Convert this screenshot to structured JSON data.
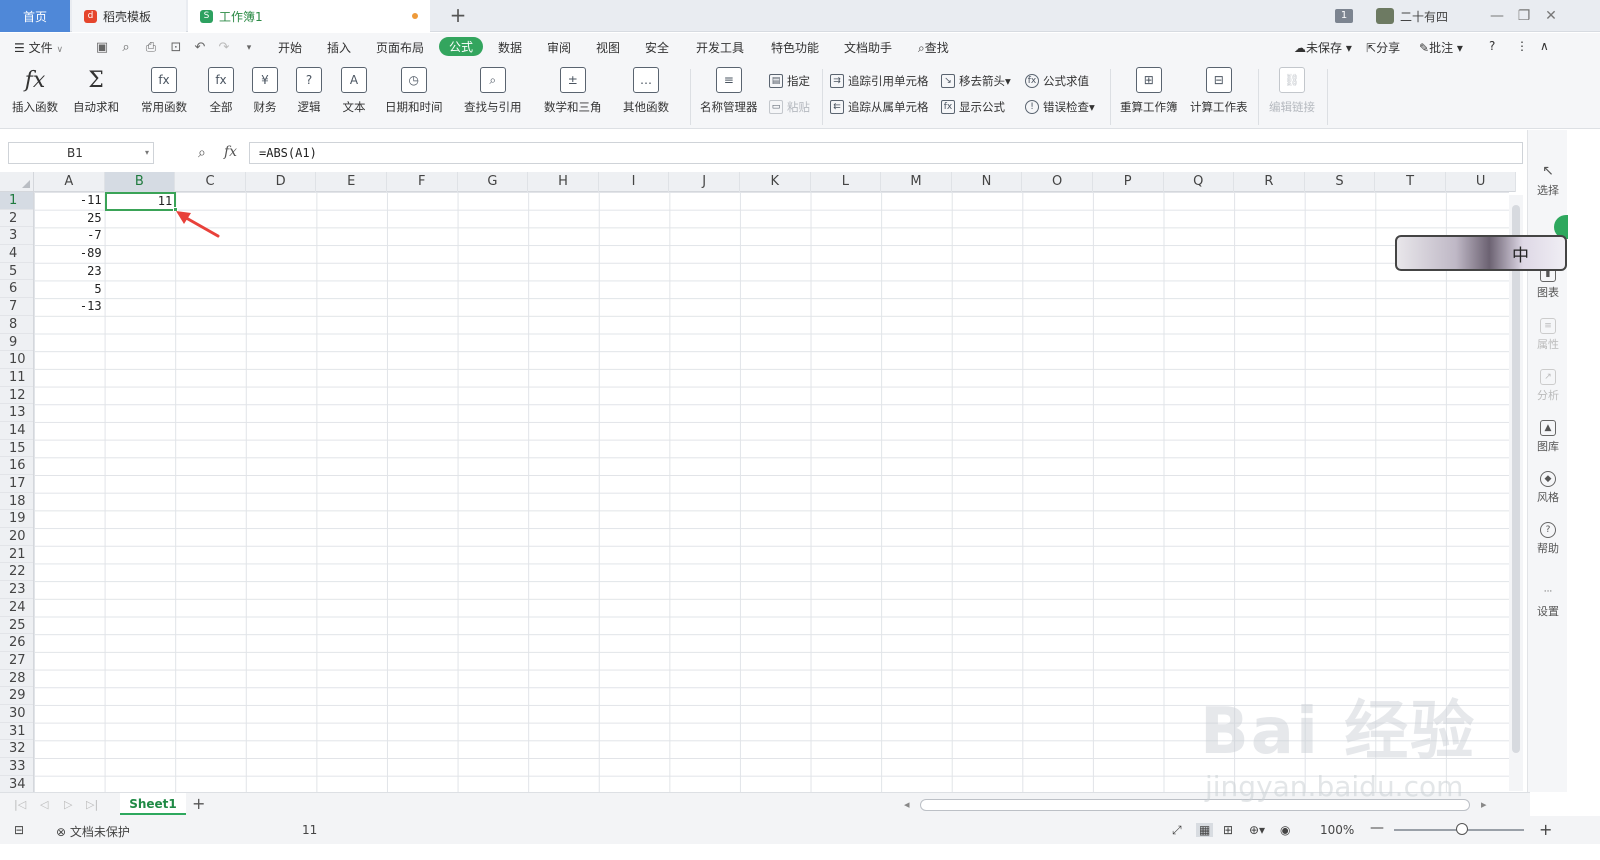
{
  "tabs": [
    {
      "label": "首页",
      "active": false
    },
    {
      "label": "稻壳模板",
      "active": false
    },
    {
      "label": "工作簿1",
      "active": true
    }
  ],
  "window": {
    "badge": "1",
    "user": "二十有四"
  },
  "menu": {
    "file": "文件",
    "items": [
      "开始",
      "插入",
      "页面布局",
      "公式",
      "数据",
      "审阅",
      "视图",
      "安全",
      "开发工具",
      "特色功能",
      "文档助手"
    ],
    "active": "公式",
    "search": "查找",
    "unsaved": "未保存",
    "share": "分享",
    "comment": "批注"
  },
  "ribbon": {
    "insert_function": "插入函数",
    "autosum": "自动求和",
    "common": "常用函数",
    "all": "全部",
    "finance": "财务",
    "logic": "逻辑",
    "text": "文本",
    "datetime": "日期和时间",
    "lookup": "查找与引用",
    "math": "数学和三角",
    "other": "其他函数",
    "name_manager": "名称管理器",
    "define": "指定",
    "paste": "粘贴",
    "trace_precedents": "追踪引用单元格",
    "trace_dependents": "追踪从属单元格",
    "remove_arrows": "移去箭头",
    "show_formulas": "显示公式",
    "evaluate": "公式求值",
    "error_check": "错误检查",
    "recalc_book": "重算工作簿",
    "calc_sheet": "计算工作表",
    "edit_links": "编辑链接"
  },
  "formula_bar": {
    "name_box": "B1",
    "formula": "=ABS(A1)"
  },
  "columns": [
    "A",
    "B",
    "C",
    "D",
    "E",
    "F",
    "G",
    "H",
    "I",
    "J",
    "K",
    "L",
    "M",
    "N",
    "O",
    "P",
    "Q",
    "R",
    "S",
    "T",
    "U"
  ],
  "rows": [
    "1",
    "2",
    "3",
    "4",
    "5",
    "6",
    "7",
    "8",
    "9",
    "10",
    "11",
    "12",
    "13",
    "14",
    "15",
    "16",
    "17",
    "18",
    "19",
    "20",
    "21",
    "22",
    "23",
    "24",
    "25",
    "26",
    "27",
    "28",
    "29",
    "30",
    "31",
    "32",
    "33",
    "34"
  ],
  "cells_a": [
    "-11",
    "25",
    "-7",
    "-89",
    "23",
    "5",
    "-13"
  ],
  "active_cell": {
    "ref": "B1",
    "value": "11"
  },
  "sidebar": [
    "选择",
    "图表",
    "属性",
    "分析",
    "图库",
    "风格",
    "帮助",
    "设置"
  ],
  "ime": "中",
  "sheet_tab": "Sheet1",
  "status": {
    "protect": "文档未保护",
    "sum": "11",
    "zoom": "100%"
  },
  "watermark": {
    "main": "Bai 经验",
    "url": "jingyan.baidu.com"
  },
  "colors": {
    "accent": "#33a55e",
    "tab_home": "#4f88d8",
    "arrow": "#e8413a"
  }
}
